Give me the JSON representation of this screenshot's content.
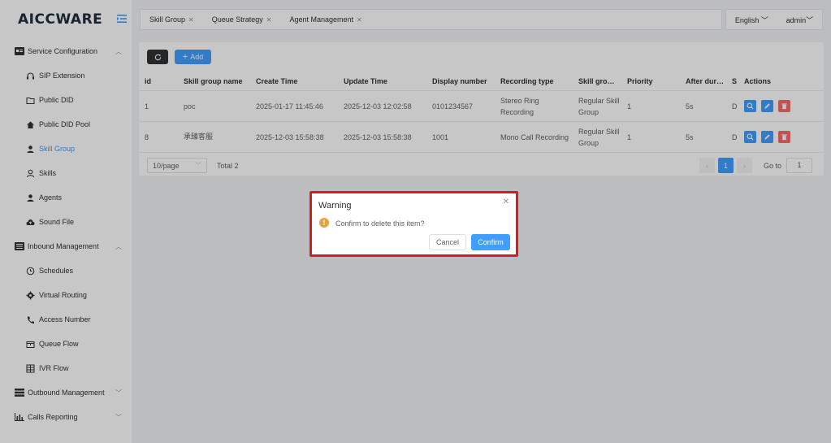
{
  "app": {
    "logo": "AICCWARE",
    "logo_part1": "AICC",
    "logo_part2": "WARE"
  },
  "colors": {
    "primary": "#409eff",
    "danger": "#f56c6c",
    "warning": "#e6a23c",
    "highlight_border": "#d81c1c"
  },
  "sidebar": {
    "groups": [
      {
        "label": "Service Configuration",
        "icon": "id-card-icon",
        "expanded": true,
        "items": [
          {
            "label": "SIP Extension",
            "icon": "headset-icon"
          },
          {
            "label": "Public DID",
            "icon": "folder-icon"
          },
          {
            "label": "Public DID Pool",
            "icon": "home-icon"
          },
          {
            "label": "Skill Group",
            "icon": "user-icon",
            "active": true
          },
          {
            "label": "Skills",
            "icon": "user-outline-icon"
          },
          {
            "label": "Agents",
            "icon": "user-icon"
          },
          {
            "label": "Sound File",
            "icon": "cloud-upload-icon"
          }
        ]
      },
      {
        "label": "Inbound Management",
        "icon": "list-icon",
        "expanded": true,
        "items": [
          {
            "label": "Schedules",
            "icon": "clock-icon"
          },
          {
            "label": "Virtual Routing",
            "icon": "gear-icon"
          },
          {
            "label": "Access Number",
            "icon": "phone-icon"
          },
          {
            "label": "Queue Flow",
            "icon": "box-icon"
          },
          {
            "label": "IVR Flow",
            "icon": "grid-icon"
          }
        ]
      },
      {
        "label": "Outbound Management",
        "icon": "list-icon",
        "expanded": false
      },
      {
        "label": "Calls Reporting",
        "icon": "bar-chart-icon",
        "expanded": false
      }
    ]
  },
  "tabs": [
    {
      "label": "Skill Group"
    },
    {
      "label": "Queue Strategy"
    },
    {
      "label": "Agent Management"
    }
  ],
  "header": {
    "language": "English",
    "user": "admin"
  },
  "toolbar": {
    "add_label": "Add"
  },
  "table": {
    "columns": [
      "id",
      "Skill group name",
      "Create Time",
      "Update Time",
      "Display number",
      "Recording type",
      "Skill gro…",
      "Priority",
      "After dur…",
      "Se",
      "Actions"
    ],
    "rows": [
      {
        "id": "1",
        "name": "poc",
        "create": "2025-01-17 11:45:46",
        "update": "2025-12-03 12:02:58",
        "display": "0101234567",
        "recording": "Stereo Ring Recording",
        "skill": "Regular Skill Group",
        "priority": "1",
        "after": "5s",
        "se": "Dis"
      },
      {
        "id": "8",
        "name": "承臻客服",
        "create": "2025-12-03 15:58:38",
        "update": "2025-12-03 15:58:38",
        "display": "1001",
        "recording": "Mono Call Recording",
        "skill": "Regular Skill Group",
        "priority": "1",
        "after": "5s",
        "se": "Dis"
      }
    ]
  },
  "pagination": {
    "page_size": "10/page",
    "total": "Total 2",
    "current": "1",
    "goto_label": "Go to",
    "goto_value": "1"
  },
  "dialog": {
    "title": "Warning",
    "message": "Confirm to delete this item?",
    "cancel": "Cancel",
    "confirm": "Confirm"
  }
}
